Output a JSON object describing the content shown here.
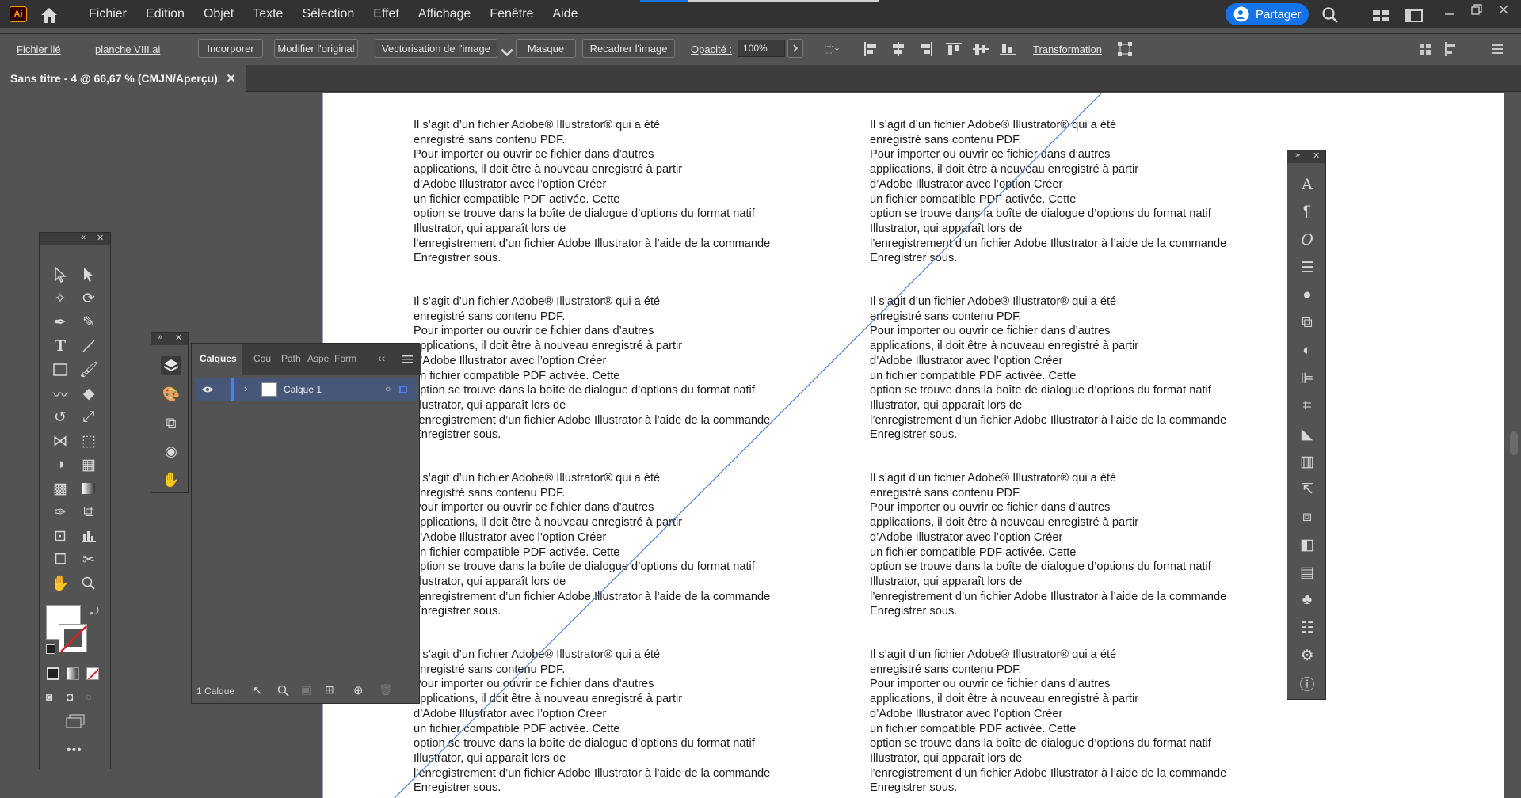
{
  "app": {
    "logo": "Ai"
  },
  "menubar": {
    "items": [
      "Fichier",
      "Edition",
      "Objet",
      "Texte",
      "Sélection",
      "Effet",
      "Affichage",
      "Fenêtre",
      "Aide"
    ],
    "share_label": "Partager",
    "accent": "#1473e6"
  },
  "controlbar": {
    "linked_file": "Fichier lié",
    "file_name": "planche VIII.ai",
    "embed": "Incorporer",
    "edit_original": "Modifier l'original",
    "image_trace": "Vectorisation de l'image",
    "mask": "Masque",
    "crop_image": "Recadrer l'image",
    "opacity_label": "Opacité :",
    "opacity_value": "100%",
    "transform": "Transformation"
  },
  "document": {
    "tab_title": "Sans titre - 4 @ 66,67 % (CMJN/Aperçu)",
    "paragraph": "Il s’agit d’un fichier Adobe® Illustrator® qui a été\nenregistré sans contenu PDF.\nPour importer ou ouvrir ce fichier dans d’autres\napplications, il doit être à nouveau enregistré à partir\nd’Adobe Illustrator avec l’option Créer\nun fichier compatible PDF activée. Cette\noption se trouve dans la boîte de dialogue d’options du format natif\nIllustrator, qui apparaît lors de\nl’enregistrement d’un fichier Adobe Illustrator à l’aide de la commande\nEnregistrer sous."
  },
  "layers_panel": {
    "tabs": [
      "Calques",
      "Cou",
      "Path",
      "Aspe",
      "Form"
    ],
    "layer_name": "Calque 1",
    "footer_count": "1 Calque"
  },
  "tools": [
    "selection-tool",
    "direct-selection-tool",
    "magic-wand-tool",
    "lasso-tool",
    "pen-tool",
    "curvature-tool",
    "type-tool",
    "line-tool",
    "rectangle-tool",
    "paintbrush-tool",
    "shaper-tool",
    "eraser-tool",
    "rotate-tool",
    "scale-tool",
    "width-tool",
    "free-transform-tool",
    "shape-builder-tool",
    "perspective-grid-tool",
    "mesh-tool",
    "gradient-tool",
    "eyedropper-tool",
    "blend-tool",
    "symbol-sprayer-tool",
    "column-graph-tool",
    "artboard-tool",
    "slice-tool",
    "hand-tool",
    "zoom-tool"
  ]
}
